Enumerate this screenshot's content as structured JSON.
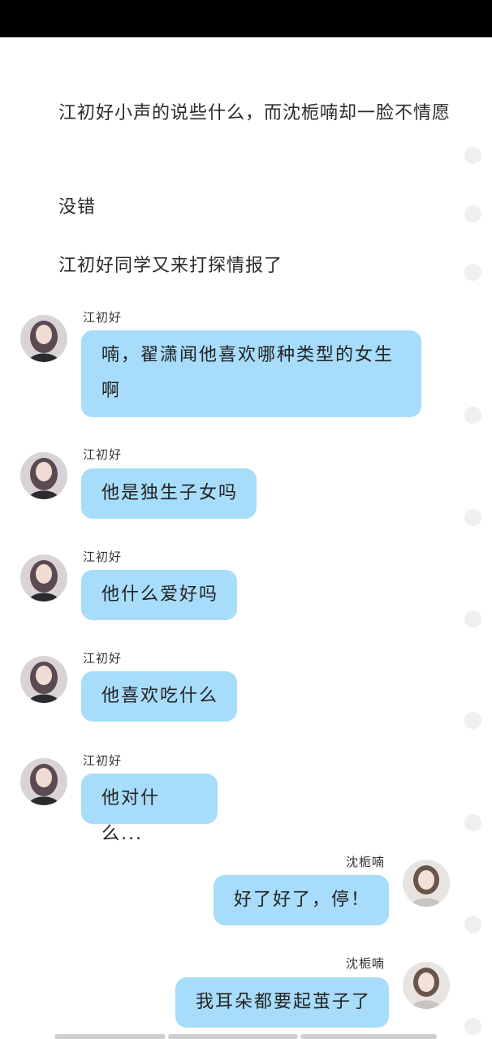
{
  "narration": [
    "江初好小声的说些什么，而沈栀喃却一脸不情愿",
    "没错",
    "江初好同学又来打探情报了"
  ],
  "messages": [
    {
      "speaker": "江初好",
      "text": "喃，翟潇闻他喜欢哪种类型的女生啊"
    },
    {
      "speaker": "江初好",
      "text": "他是独生子女吗"
    },
    {
      "speaker": "江初好",
      "text": "他什么爱好吗"
    },
    {
      "speaker": "江初好",
      "text": "他喜欢吃什么"
    },
    {
      "speaker": "江初好",
      "text": "他对什么..."
    },
    {
      "speaker": "沈栀喃",
      "text": "好了好了，停！"
    },
    {
      "speaker": "沈栀喃",
      "text": "我耳朵都要起茧子了"
    }
  ],
  "colors": {
    "bubble": "#a7dcfb",
    "status_bar": "#000000",
    "side_dot": "#efefef"
  }
}
